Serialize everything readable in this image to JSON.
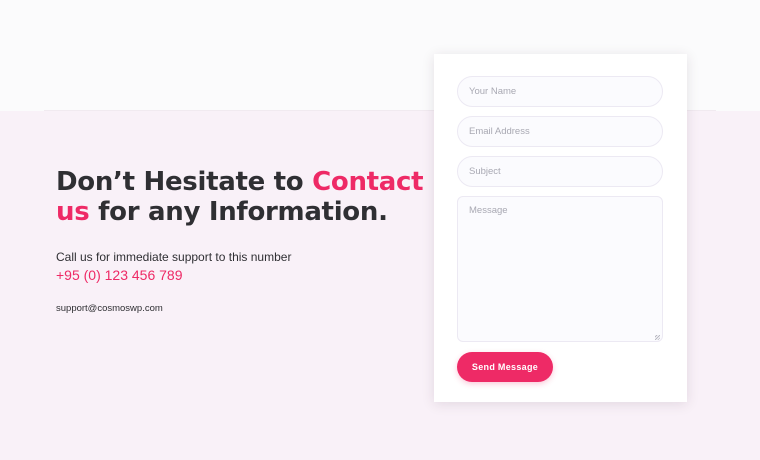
{
  "hero": {
    "headline_part1": "Don’t Hesitate to ",
    "headline_accent1": "Contact us",
    "headline_part2": " for any Information.",
    "support_text": "Call us for immediate support to this number",
    "phone": "+95 (0) 123 456 789",
    "email": "support@cosmoswp.com"
  },
  "form": {
    "name_placeholder": "Your Name",
    "email_placeholder": "Email Address",
    "subject_placeholder": "Subject",
    "message_placeholder": "Message",
    "submit_label": "Send Message"
  },
  "colors": {
    "accent": "#ee2a66",
    "text": "#2f2f33",
    "band_bg": "#f9f1f8",
    "page_bg": "#fbfbfc"
  }
}
